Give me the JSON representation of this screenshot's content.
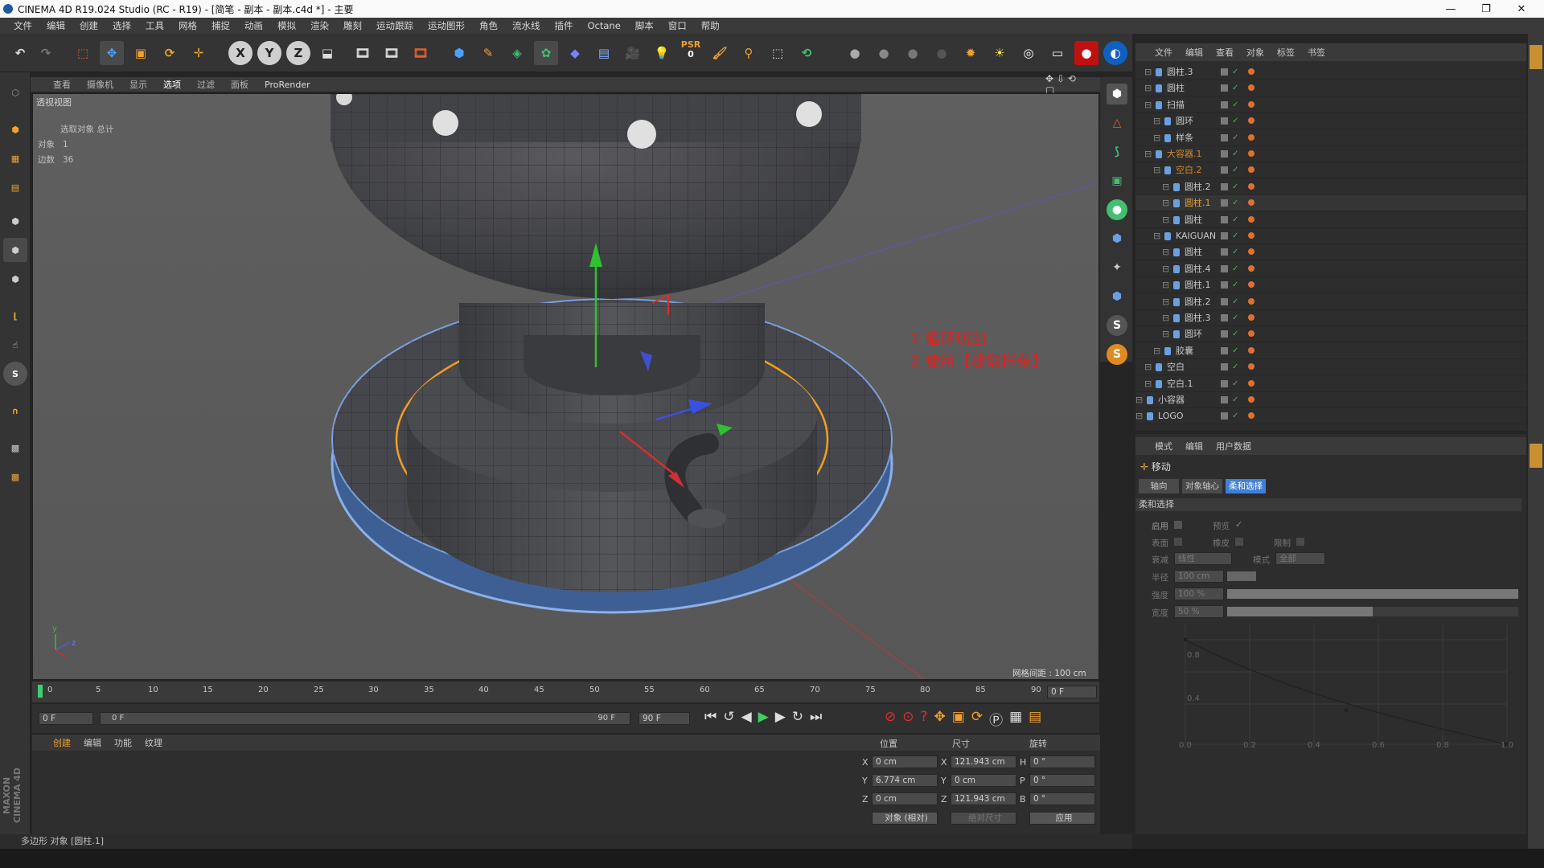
{
  "titlebar": {
    "title": "CINEMA 4D R19.024 Studio (RC - R19) - [简笔 - 副本 - 副本.c4d *] - 主要",
    "minimize": "—",
    "maximize": "❐",
    "close": "✕"
  },
  "menubar": [
    "文件",
    "编辑",
    "创建",
    "选择",
    "工具",
    "网格",
    "捕捉",
    "动画",
    "模拟",
    "渲染",
    "雕刻",
    "运动跟踪",
    "运动图形",
    "角色",
    "流水线",
    "插件",
    "Octane",
    "脚本",
    "窗口",
    "帮助"
  ],
  "toolbar": {
    "axis_x": "X",
    "axis_y": "Y",
    "axis_z": "Z",
    "psr": "PSR",
    "psr_value": "0"
  },
  "viewport": {
    "menu": [
      "查看",
      "摄像机",
      "显示",
      "选项",
      "过滤",
      "面板",
      "ProRender"
    ],
    "view_name": "透视视图",
    "info_header": "选取对象  总计",
    "info_object_label": "对象",
    "info_object_value": "1",
    "info_edge_label": "边数",
    "info_edge_value": "36",
    "annotation_1": "1 循环切割",
    "annotation_2": "2 使用【提取样条】",
    "grid_spacing": "网格间距 : 100 cm",
    "axis_y": "y",
    "axis_z": "z"
  },
  "timeline": {
    "ticks": [
      "0",
      "5",
      "10",
      "15",
      "20",
      "25",
      "30",
      "35",
      "40",
      "45",
      "50",
      "55",
      "60",
      "65",
      "70",
      "75",
      "80",
      "85",
      "90"
    ],
    "current_frame": "0 F"
  },
  "transport": {
    "start_field": "0 F",
    "slider_start": "0 F",
    "slider_end": "90 F",
    "end_field": "90 F"
  },
  "material_panel": {
    "tabs": [
      "创建",
      "编辑",
      "功能",
      "纹理"
    ]
  },
  "coords": {
    "headers": [
      "位置",
      "尺寸",
      "旋转"
    ],
    "rows": [
      {
        "axis": "X",
        "pos": "0 cm",
        "size_axis": "X",
        "size": "121.943 cm",
        "rot_axis": "H",
        "rot": "0 °"
      },
      {
        "axis": "Y",
        "pos": "6.774 cm",
        "size_axis": "Y",
        "size": "0 cm",
        "rot_axis": "P",
        "rot": "0 °"
      },
      {
        "axis": "Z",
        "pos": "0 cm",
        "size_axis": "Z",
        "size": "121.943 cm",
        "rot_axis": "B",
        "rot": "0 °"
      }
    ],
    "mode": "对象 (相对)",
    "size_mode": "绝对尺寸",
    "apply": "应用"
  },
  "statusbar": "多边形 对象 [圆柱.1]",
  "brand": "MAXON CINEMA 4D",
  "object_manager": {
    "menu": [
      "文件",
      "编辑",
      "查看",
      "对象",
      "标签",
      "书签"
    ],
    "items": [
      {
        "name": "圆柱.3",
        "indent": 1,
        "color": "#c8c8c8"
      },
      {
        "name": "圆柱",
        "indent": 1,
        "color": "#c8c8c8"
      },
      {
        "name": "扫描",
        "indent": 1,
        "color": "#c8c8c8"
      },
      {
        "name": "圆环",
        "indent": 2,
        "color": "#c8c8c8"
      },
      {
        "name": "样条",
        "indent": 2,
        "color": "#c8c8c8"
      },
      {
        "name": "大容器.1",
        "indent": 1,
        "color": "#d08a2a"
      },
      {
        "name": "空白.2",
        "indent": 2,
        "color": "#d08a2a"
      },
      {
        "name": "圆柱.2",
        "indent": 3,
        "color": "#c8c8c8"
      },
      {
        "name": "圆柱.1",
        "indent": 3,
        "color": "#e0a030"
      },
      {
        "name": "圆柱",
        "indent": 3,
        "color": "#c8c8c8"
      },
      {
        "name": "KAIGUAN",
        "indent": 2,
        "color": "#c8c8c8"
      },
      {
        "name": "圆柱",
        "indent": 3,
        "color": "#c8c8c8"
      },
      {
        "name": "圆柱.4",
        "indent": 3,
        "color": "#c8c8c8"
      },
      {
        "name": "圆柱.1",
        "indent": 3,
        "color": "#c8c8c8"
      },
      {
        "name": "圆柱.2",
        "indent": 3,
        "color": "#c8c8c8"
      },
      {
        "name": "圆柱.3",
        "indent": 3,
        "color": "#c8c8c8"
      },
      {
        "name": "圆环",
        "indent": 3,
        "color": "#c8c8c8"
      },
      {
        "name": "胶囊",
        "indent": 2,
        "color": "#c8c8c8"
      },
      {
        "name": "空白",
        "indent": 1,
        "color": "#c8c8c8"
      },
      {
        "name": "空白.1",
        "indent": 1,
        "color": "#c8c8c8"
      },
      {
        "name": "小容器",
        "indent": 0,
        "color": "#c8c8c8"
      },
      {
        "name": "LOGO",
        "indent": 0,
        "color": "#c8c8c8"
      }
    ]
  },
  "attributes": {
    "menu": [
      "模式",
      "编辑",
      "用户数据"
    ],
    "tool_name": "移动",
    "tabs": [
      "轴向",
      "对象轴心",
      "柔和选择"
    ],
    "section": "柔和选择",
    "enable_label": "启用",
    "preview_label": "预览",
    "surface_label": "表面",
    "rubber_label": "橡皮",
    "limit_label": "限制",
    "falloff_label": "衰减",
    "falloff_value": "线性",
    "mode_label": "模式",
    "mode_value": "全部",
    "radius_label": "半径",
    "radius_value": "100 cm",
    "strength_label": "强度",
    "strength_value": "100 %",
    "strength_level": 1.0,
    "width_label": "宽度",
    "width_value": "50 %",
    "width_level": 0.5,
    "curve_y_ticks": [
      "0.8",
      "0.4"
    ],
    "curve_x_ticks": [
      "0.0",
      "0.2",
      "0.4",
      "0.6",
      "0.8",
      "1.0"
    ]
  },
  "colors": {
    "accent_blue": "#3f7fd8",
    "annotation_red": "#e02020",
    "selection_orange": "#f0a020"
  }
}
